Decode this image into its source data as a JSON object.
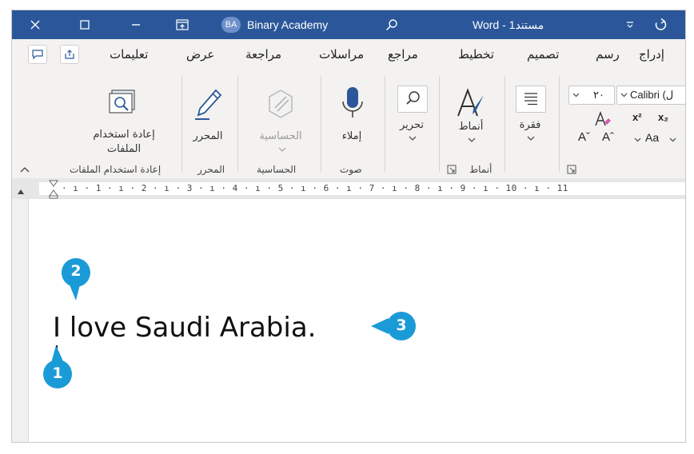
{
  "titlebar": {
    "close_icon": "close-icon",
    "restore_icon": "restore-icon",
    "minimize_icon": "minimize-icon",
    "display_icon": "ribbon-display-icon",
    "avatar_initials": "BA",
    "account_name": "Binary Academy",
    "search_icon": "search-icon",
    "doc_title": "Word - مستند1",
    "customize_icon": "quick-access-dropdown-icon",
    "undo_icon": "undo-icon",
    "bar_color": "#2b579a"
  },
  "tabs": [
    "تعليمات",
    "عرض",
    "مراجعة",
    "مراسلات",
    "مراجع",
    "تخطيط",
    "تصميم",
    "رسم",
    "إدراج"
  ],
  "ribbon": {
    "reuse_files_label_line1": "إعادة استخدام",
    "reuse_files_label_line2": "الملفات",
    "reuse_files_group": "إعادة استخدام الملفات",
    "editor_label": "المحرر",
    "editor_group": "المحرر",
    "sensitivity_label": "الحساسية",
    "sensitivity_group": "الحساسية",
    "dictate_label": "إملاء",
    "voice_group": "صوت",
    "editing_label": "تحرير",
    "styles_label": "أنماط",
    "styles_group": "أنماط",
    "paragraph_label": "فقرة",
    "font_size": "٢٠",
    "font_name": "Calibri (ل",
    "superscript": "x²",
    "subscript": "x₂",
    "grow_font": "Aˇ",
    "shrink_font": "Aˆ",
    "change_case": "Aa"
  },
  "ruler": {
    "text": "· ı · 1 · ı · 2 · ı · 3 · ı · 4 · ı · 5 · ı · 6 · ı · 7 · ı · 8 · ı · 9 · ı · 10 · ı · 11"
  },
  "document": {
    "body_text": "I love Saudi Arabia."
  },
  "callouts": {
    "one": "1",
    "two": "2",
    "three": "3",
    "color": "#1a9bd7"
  }
}
